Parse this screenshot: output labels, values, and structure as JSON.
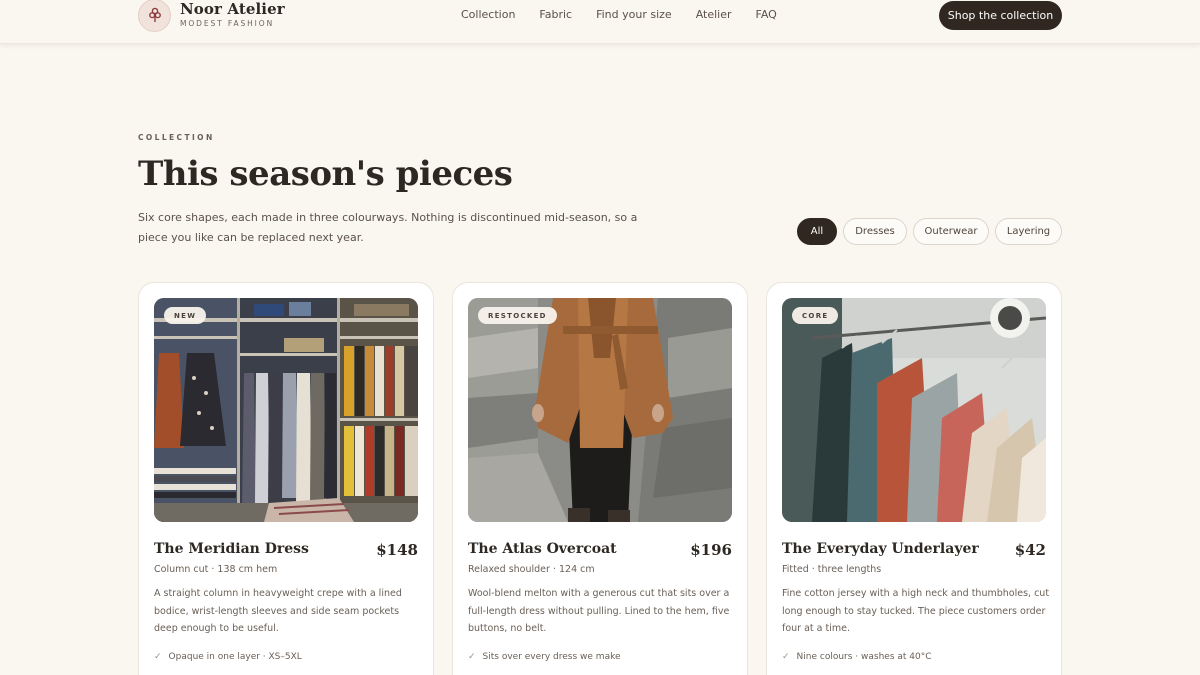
{
  "brand": {
    "name": "Noor Atelier",
    "tagline": "MODEST FASHION",
    "logo_icon": "flower-icon"
  },
  "nav": {
    "items": [
      "Collection",
      "Fabric",
      "Find your size",
      "Atelier",
      "FAQ"
    ],
    "cta": "Shop the collection"
  },
  "section": {
    "eyebrow": "COLLECTION",
    "title": "This season's pieces",
    "lead": "Six core shapes, each made in three colourways. Nothing is discontinued mid-season, so a piece you like can be replaced next year."
  },
  "filters": {
    "items": [
      "All",
      "Dresses",
      "Outerwear",
      "Layering"
    ],
    "active": "All"
  },
  "products": [
    {
      "badge": "NEW",
      "name": "The Meridian Dress",
      "price": "$148",
      "meta": "Column cut · 138 cm hem",
      "description": "A straight column in heavyweight crepe with a lined bodice, wrist-length sleeves and side seam pockets deep enough to be useful.",
      "feature": "Opaque in one layer · XS–5XL"
    },
    {
      "badge": "RESTOCKED",
      "name": "The Atlas Overcoat",
      "price": "$196",
      "meta": "Relaxed shoulder · 124 cm",
      "description": "Wool-blend melton with a generous cut that sits over a full-length dress without pulling. Lined to the hem, five buttons, no belt.",
      "feature": "Sits over every dress we make"
    },
    {
      "badge": "CORE",
      "name": "The Everyday Underlayer",
      "price": "$42",
      "meta": "Fitted · three lengths",
      "description": "Fine cotton jersey with a high neck and thumbholes, cut long enough to stay tucked. The piece customers order four at a time.",
      "feature": "Nine colours · washes at 40°C"
    }
  ],
  "colors": {
    "accent_dark": "#2f2720",
    "background": "#faf6f0",
    "check": "#8a9a7c"
  }
}
